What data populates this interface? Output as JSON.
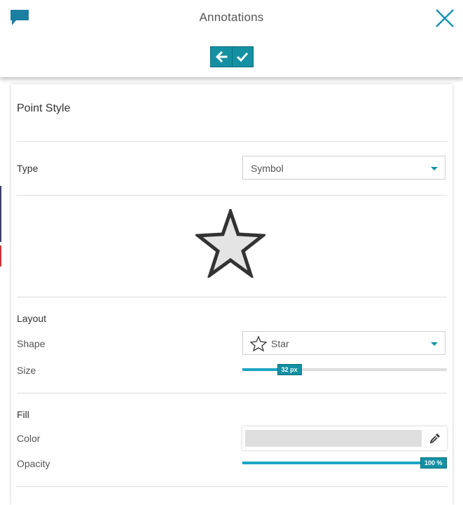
{
  "header": {
    "title": "Annotations",
    "icons": {
      "chat": "chat-bubble-icon",
      "close": "close-icon",
      "back": "arrow-left-icon",
      "confirm": "checkmark-icon"
    }
  },
  "panel": {
    "title": "Point Style",
    "type": {
      "label": "Type",
      "value": "Symbol"
    },
    "preview": {
      "icon": "star-icon"
    },
    "layout": {
      "title": "Layout",
      "shape": {
        "label": "Shape",
        "value": "Star",
        "icon": "star-outline-icon"
      },
      "size": {
        "label": "Size",
        "value_text": "32 px",
        "fraction": 0.23
      }
    },
    "fill": {
      "title": "Fill",
      "color": {
        "label": "Color",
        "value": "#dedede",
        "icon": "eyedropper-icon"
      },
      "opacity": {
        "label": "Opacity",
        "value_text": "100 %",
        "fraction": 1.0
      }
    }
  },
  "colors": {
    "accent": "#1490a3",
    "slider_fill": "#1ba6c5",
    "chat_icon": "#1a7fa0"
  }
}
